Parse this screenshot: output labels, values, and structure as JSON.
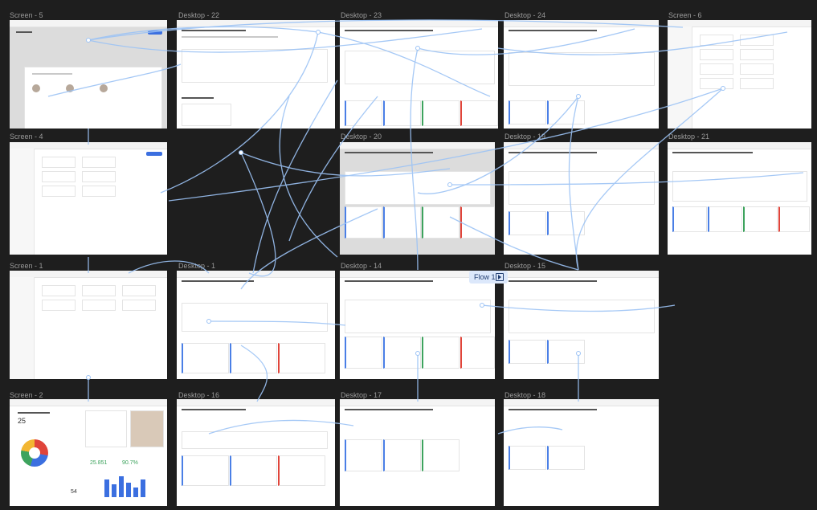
{
  "canvas": {
    "background": "#1e1e1e",
    "accent": "#3b6fe0",
    "flow_line_color": "#9cc3f5"
  },
  "frames": [
    {
      "id": "screen-5",
      "label": "Screen - 5"
    },
    {
      "id": "desktop-22",
      "label": "Desktop - 22"
    },
    {
      "id": "desktop-23",
      "label": "Desktop - 23"
    },
    {
      "id": "desktop-24",
      "label": "Desktop - 24"
    },
    {
      "id": "screen-6",
      "label": "Screen - 6"
    },
    {
      "id": "screen-4",
      "label": "Screen - 4"
    },
    {
      "id": "desktop-20",
      "label": "Desktop - 20"
    },
    {
      "id": "desktop-19",
      "label": "Desktop - 19"
    },
    {
      "id": "desktop-21",
      "label": "Desktop - 21"
    },
    {
      "id": "screen-1",
      "label": "Screen - 1"
    },
    {
      "id": "desktop-1",
      "label": "Desktop - 1"
    },
    {
      "id": "desktop-14",
      "label": "Desktop - 14"
    },
    {
      "id": "desktop-15",
      "label": "Desktop - 15"
    },
    {
      "id": "screen-2",
      "label": "Screen - 2"
    },
    {
      "id": "desktop-16",
      "label": "Desktop - 16"
    },
    {
      "id": "desktop-17",
      "label": "Desktop - 17"
    },
    {
      "id": "desktop-18",
      "label": "Desktop - 18"
    }
  ],
  "flow_badge": {
    "label": "Flow 1",
    "icon": "play-icon"
  },
  "dashboard": {
    "big_number_1": "25",
    "big_number_2": "25.851",
    "big_number_3": "90.7%",
    "big_number_4": "54"
  }
}
